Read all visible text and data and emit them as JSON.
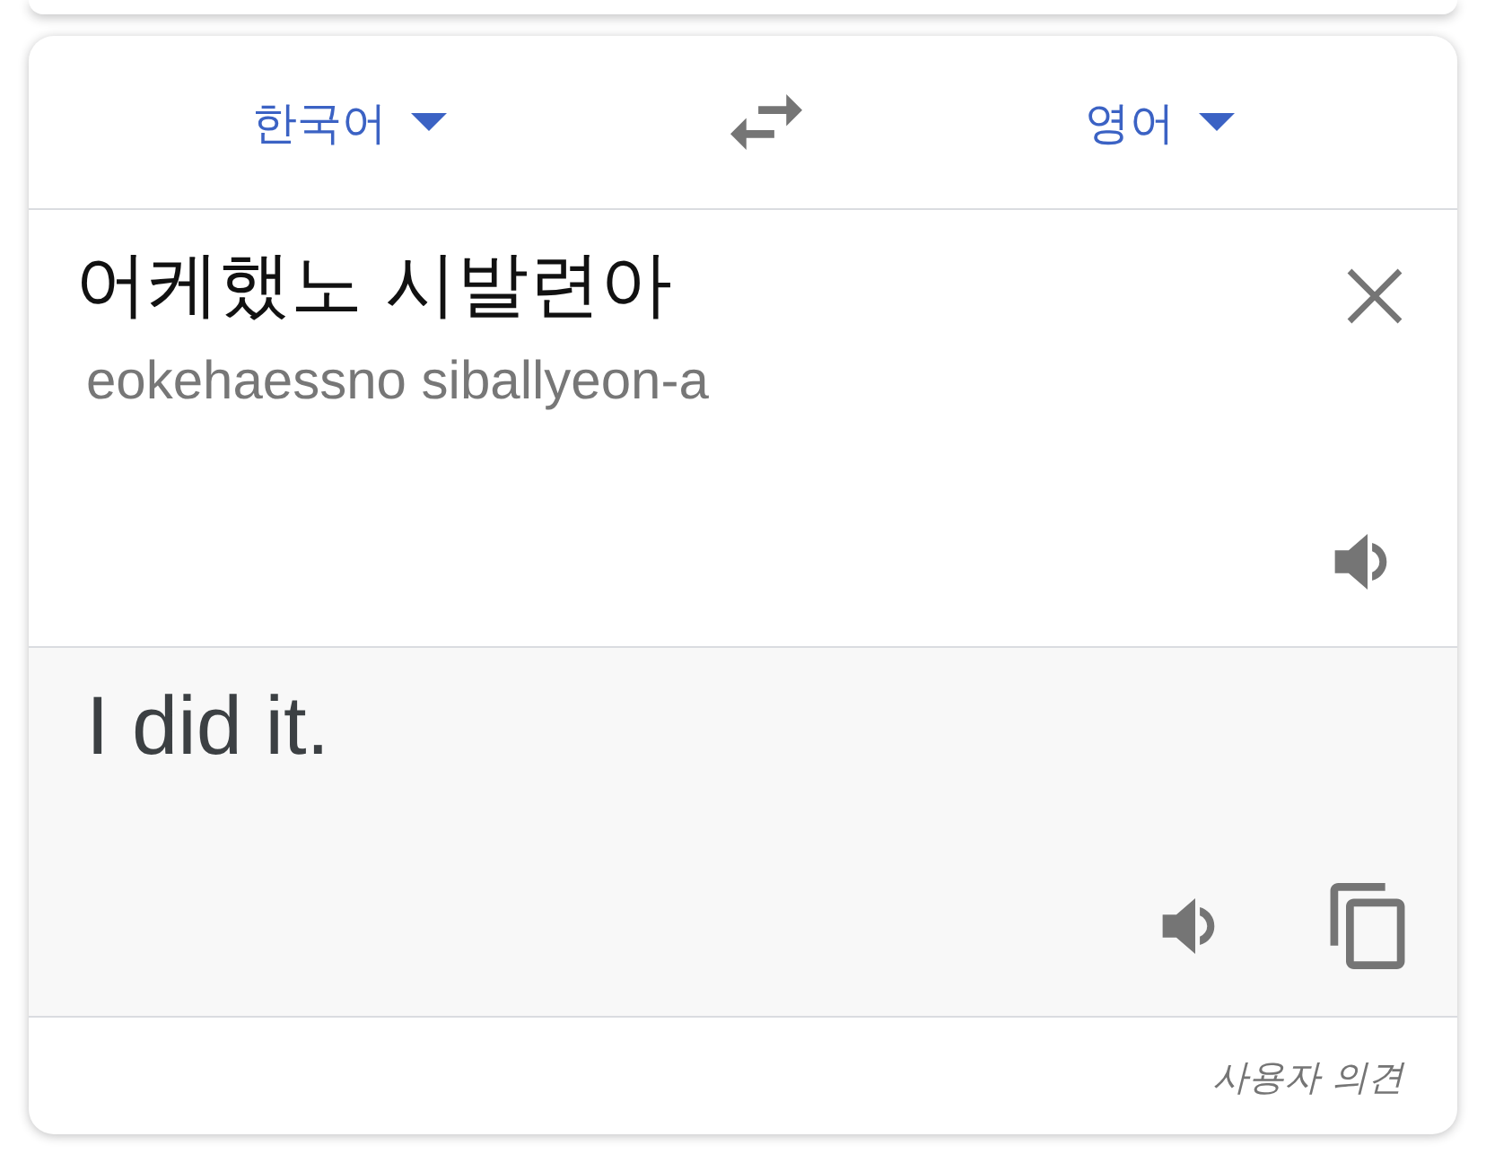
{
  "language_bar": {
    "source_language": {
      "label": "한국어"
    },
    "target_language": {
      "label": "영어"
    }
  },
  "source": {
    "text": "어케했노 시발련아",
    "romanization": "eokehaessno siballyeon-a"
  },
  "translation": {
    "text": "I did it."
  },
  "footer": {
    "feedback_link": "사용자 의견"
  }
}
